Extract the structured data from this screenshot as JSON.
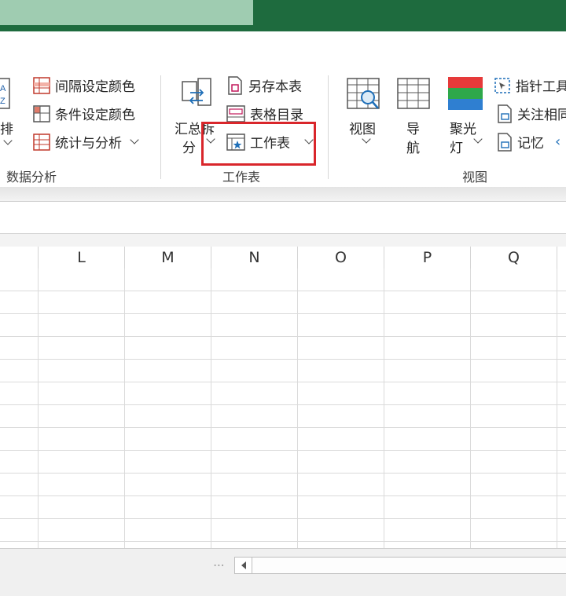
{
  "ribbon": {
    "sort_partial_label": "排",
    "data_analysis_group": {
      "label": "数据分析",
      "items": [
        {
          "label": "间隔设定颜色",
          "icon": "interval-color-icon"
        },
        {
          "label": "条件设定颜色",
          "icon": "condition-color-icon"
        },
        {
          "label": "统计与分析",
          "icon": "statistics-icon"
        }
      ]
    },
    "worksheet_group": {
      "label": "工作表",
      "summary_split": {
        "line1": "汇总拆",
        "line2": "分"
      },
      "items": [
        {
          "label": "另存本表",
          "icon": "save-sheet-icon"
        },
        {
          "label": "表格目录",
          "icon": "table-directory-icon"
        },
        {
          "label": "工作表",
          "icon": "worksheet-icon"
        }
      ]
    },
    "view_group": {
      "label": "视图",
      "view_button": "视图",
      "nav_button": {
        "line1": "导",
        "line2": "航"
      },
      "spotlight_button": {
        "line1": "聚光",
        "line2": "灯"
      },
      "items": [
        {
          "label": "指针工具",
          "icon": "pointer-tool-icon"
        },
        {
          "label": "关注相同",
          "icon": "focus-same-icon"
        },
        {
          "label": "记忆",
          "icon": "memory-icon"
        }
      ]
    }
  },
  "columns": [
    "L",
    "M",
    "N",
    "O",
    "P",
    "Q"
  ],
  "colors": {
    "title_bar": "#1e6b3e",
    "active_tab": "#9fccb1",
    "highlight_box": "#d9262b"
  }
}
